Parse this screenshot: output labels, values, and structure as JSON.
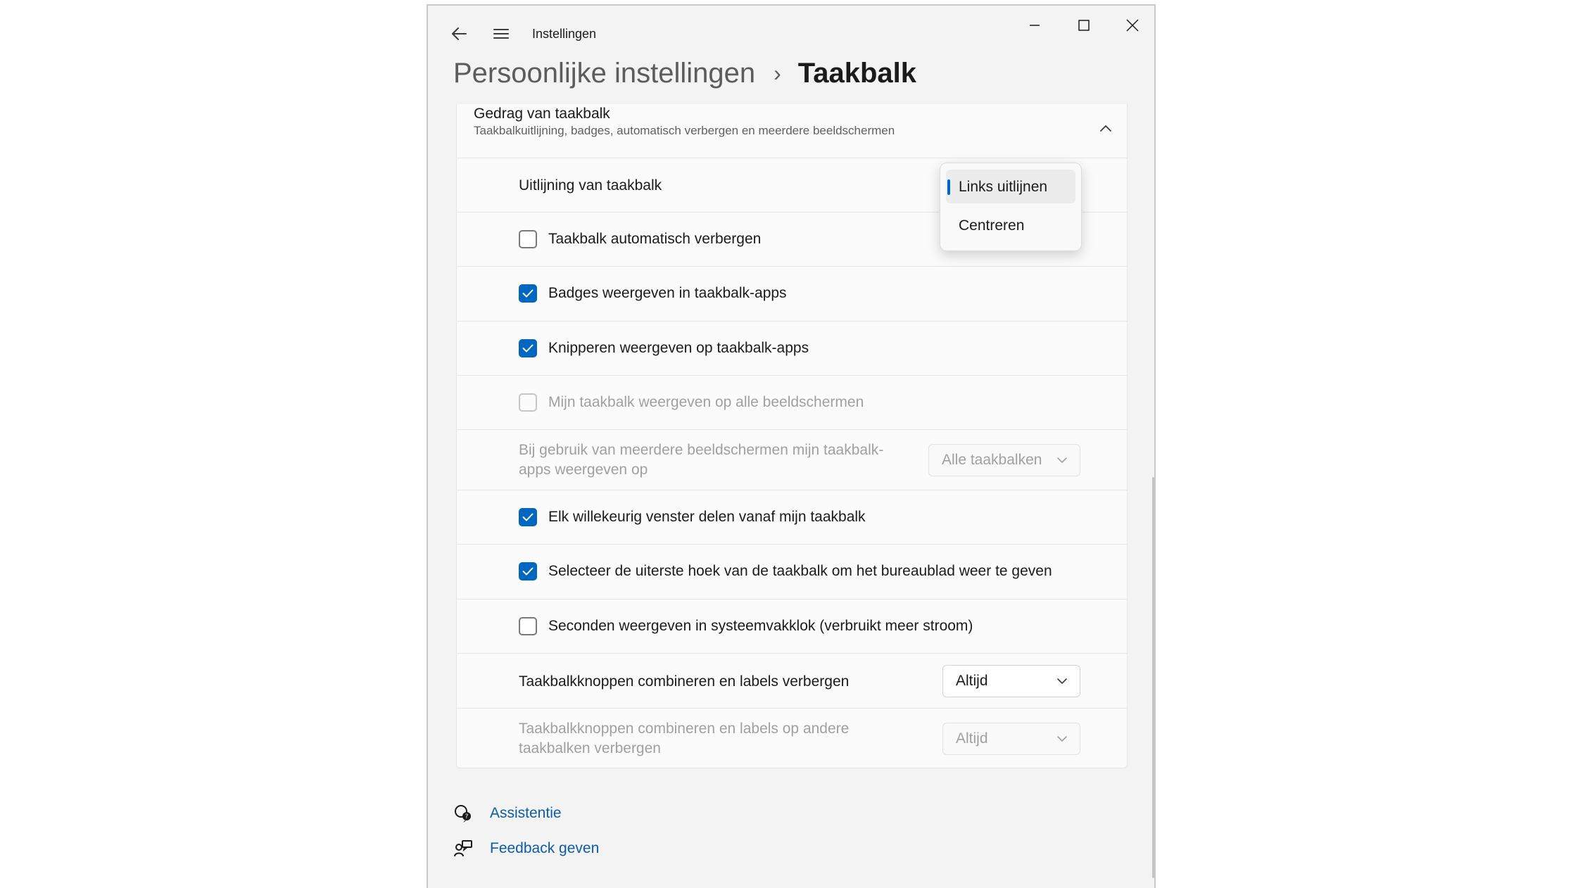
{
  "window": {
    "title": "Instellingen"
  },
  "breadcrumb": {
    "parent": "Persoonlijke instellingen",
    "separator": "›",
    "current": "Taakbalk"
  },
  "section": {
    "title": "Gedrag van taakbalk",
    "subtitle": "Taakbalkuitlijning, badges, automatisch verbergen en meerdere beeldschermen"
  },
  "alignment": {
    "label": "Uitlijning van taakbalk",
    "options": [
      "Links uitlijnen",
      "Centreren"
    ],
    "selected": "Links uitlijnen"
  },
  "settings": {
    "auto_hide": {
      "label": "Taakbalk automatisch verbergen",
      "checked": false
    },
    "badges": {
      "label": "Badges weergeven in taakbalk-apps",
      "checked": true
    },
    "flashing": {
      "label": "Knipperen weergeven op taakbalk-apps",
      "checked": true
    },
    "all_displays": {
      "label": "Mijn taakbalk weergeven op alle beeldschermen",
      "checked": false,
      "disabled": true
    },
    "multi_display_apps": {
      "label_line1": "Bij gebruik van meerdere beeldschermen mijn taakbalk-",
      "label_line2": "apps weergeven op",
      "value": "Alle taakbalken",
      "disabled": true
    },
    "share_window": {
      "label": "Elk willekeurig venster delen vanaf mijn taakbalk",
      "checked": true
    },
    "far_corner": {
      "label": "Selecteer de uiterste hoek van de taakbalk om het bureaublad weer te geven",
      "checked": true
    },
    "seconds": {
      "label": "Seconden weergeven in systeemvakklok (verbruikt meer stroom)",
      "checked": false
    },
    "combine": {
      "label": "Taakbalkknoppen combineren en labels verbergen",
      "value": "Altijd"
    },
    "combine_other": {
      "label_line1": "Taakbalkknoppen combineren en labels op andere",
      "label_line2": "taakbalken verbergen",
      "value": "Altijd",
      "disabled": true
    }
  },
  "footer": {
    "help": "Assistentie",
    "feedback": "Feedback geven"
  },
  "colors": {
    "accent": "#0067c0",
    "link": "#0b5cad",
    "background": "#f3f3f3",
    "card": "#fbfbfb"
  }
}
